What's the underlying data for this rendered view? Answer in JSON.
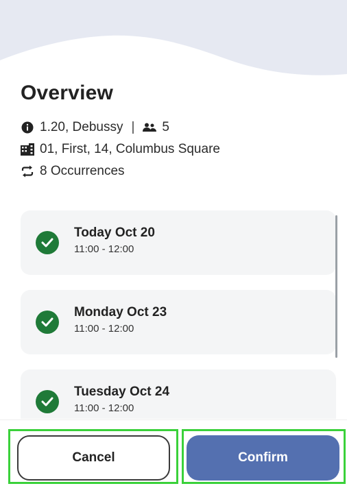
{
  "overview": {
    "title": "Overview",
    "room_line": "1.20, Debussy",
    "separator": "|",
    "capacity": "5",
    "building_line": "01, First, 14, Columbus Square",
    "occurrences_line": "8 Occurrences"
  },
  "occurrences": [
    {
      "title": "Today Oct 20",
      "time": "11:00 - 12:00"
    },
    {
      "title": "Monday Oct 23",
      "time": "11:00 - 12:00"
    },
    {
      "title": "Tuesday Oct 24",
      "time": "11:00 - 12:00"
    }
  ],
  "footer": {
    "cancel_label": "Cancel",
    "confirm_label": "Confirm"
  },
  "colors": {
    "accent": "#5470b0",
    "success": "#1f7a38",
    "highlight": "#3ad13a",
    "wave": "#e6e9f2"
  },
  "icons": {
    "info": "info-icon",
    "capacity": "people-icon",
    "building": "building-icon",
    "recurrence": "repeat-icon",
    "check": "check-circle-icon"
  }
}
